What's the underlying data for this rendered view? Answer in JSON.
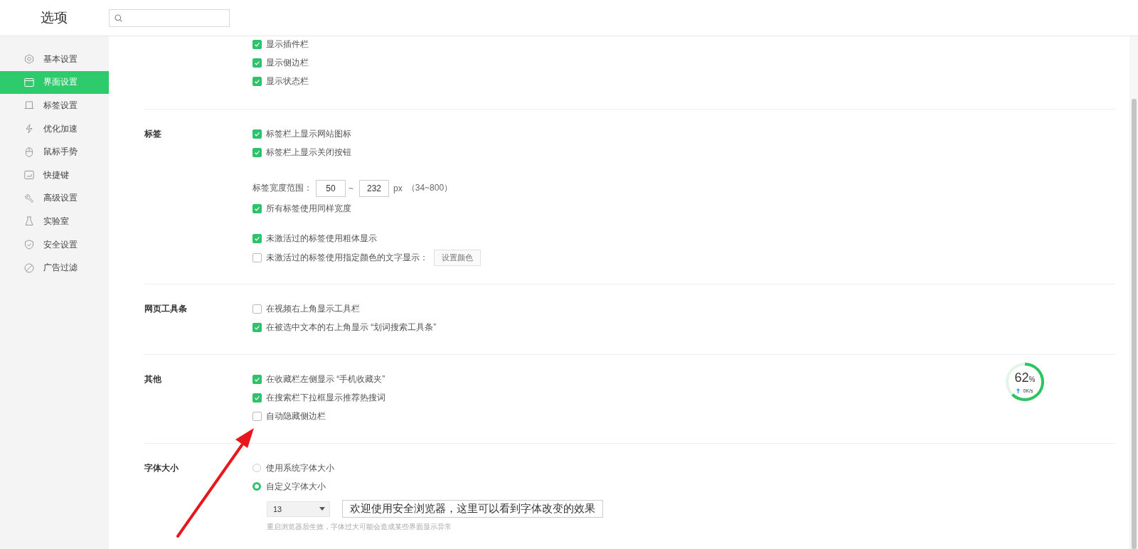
{
  "header": {
    "title": "选项"
  },
  "sidebar": {
    "items": [
      {
        "label": "基本设置",
        "selected": false
      },
      {
        "label": "界面设置",
        "selected": true
      },
      {
        "label": "标签设置",
        "selected": false
      },
      {
        "label": "优化加速",
        "selected": false
      },
      {
        "label": "鼠标手势",
        "selected": false
      },
      {
        "label": "快捷键",
        "selected": false
      },
      {
        "label": "高级设置",
        "selected": false
      },
      {
        "label": "实验室",
        "selected": false
      },
      {
        "label": "安全设置",
        "selected": false
      },
      {
        "label": "广告过滤",
        "selected": false
      }
    ]
  },
  "sections": [
    {
      "groups": [
        [
          {
            "kind": "checkbox",
            "label": "显示插件栏",
            "checked": true
          },
          {
            "kind": "checkbox",
            "label": "显示侧边栏",
            "checked": true
          },
          {
            "kind": "checkbox",
            "label": "显示状态栏",
            "checked": true
          }
        ]
      ]
    },
    {
      "title": "标签",
      "groups": [
        [
          {
            "kind": "checkbox",
            "label": "标签栏上显示网站图标",
            "checked": true
          },
          {
            "kind": "checkbox",
            "label": "标签栏上显示关闭按钮",
            "checked": true
          }
        ],
        [
          {
            "kind": "range",
            "label": "标签宽度范围：",
            "from": "50",
            "separator": "~",
            "to": "232",
            "unit": "px",
            "hint": "（34~800）"
          },
          {
            "kind": "checkbox",
            "label": "所有标签使用同样宽度",
            "checked": true
          }
        ],
        [
          {
            "kind": "checkbox",
            "label": "未激活过的标签使用粗体显示",
            "checked": true
          },
          {
            "kind": "checkbox",
            "label": "未激活过的标签使用指定颜色的文字显示：",
            "checked": false,
            "button": "设置颜色"
          }
        ]
      ]
    },
    {
      "title": "网页工具条",
      "groups": [
        [
          {
            "kind": "checkbox",
            "label": "在视频右上角显示工具栏",
            "checked": false
          },
          {
            "kind": "checkbox",
            "label": "在被选中文本的右上角显示 “划词搜索工具条”",
            "checked": true
          }
        ]
      ]
    },
    {
      "title": "其他",
      "groups": [
        [
          {
            "kind": "checkbox",
            "label": "在收藏栏左侧显示 “手机收藏夹”",
            "checked": true
          },
          {
            "kind": "checkbox",
            "label": "在搜索栏下拉框显示推荐热搜词",
            "checked": true
          },
          {
            "kind": "checkbox",
            "label": "自动隐藏侧边栏",
            "checked": false
          }
        ]
      ]
    },
    {
      "title": "字体大小",
      "groups": [
        [
          {
            "kind": "radio",
            "label": "使用系统字体大小",
            "selected": false
          },
          {
            "kind": "radio",
            "label": "自定义字体大小",
            "selected": true
          },
          {
            "kind": "font_select",
            "value": "13",
            "preview": "欢迎使用安全浏览器，这里可以看到字体改变的效果",
            "note": "重启浏览器后生效，字体过大可能会造成某些界面显示异常"
          }
        ]
      ]
    }
  ],
  "speed_widget": {
    "level": 0.62,
    "percent": "62",
    "unit": "%",
    "rate": "0K/s"
  },
  "annotations": [
    {
      "kind": "arrow"
    }
  ]
}
